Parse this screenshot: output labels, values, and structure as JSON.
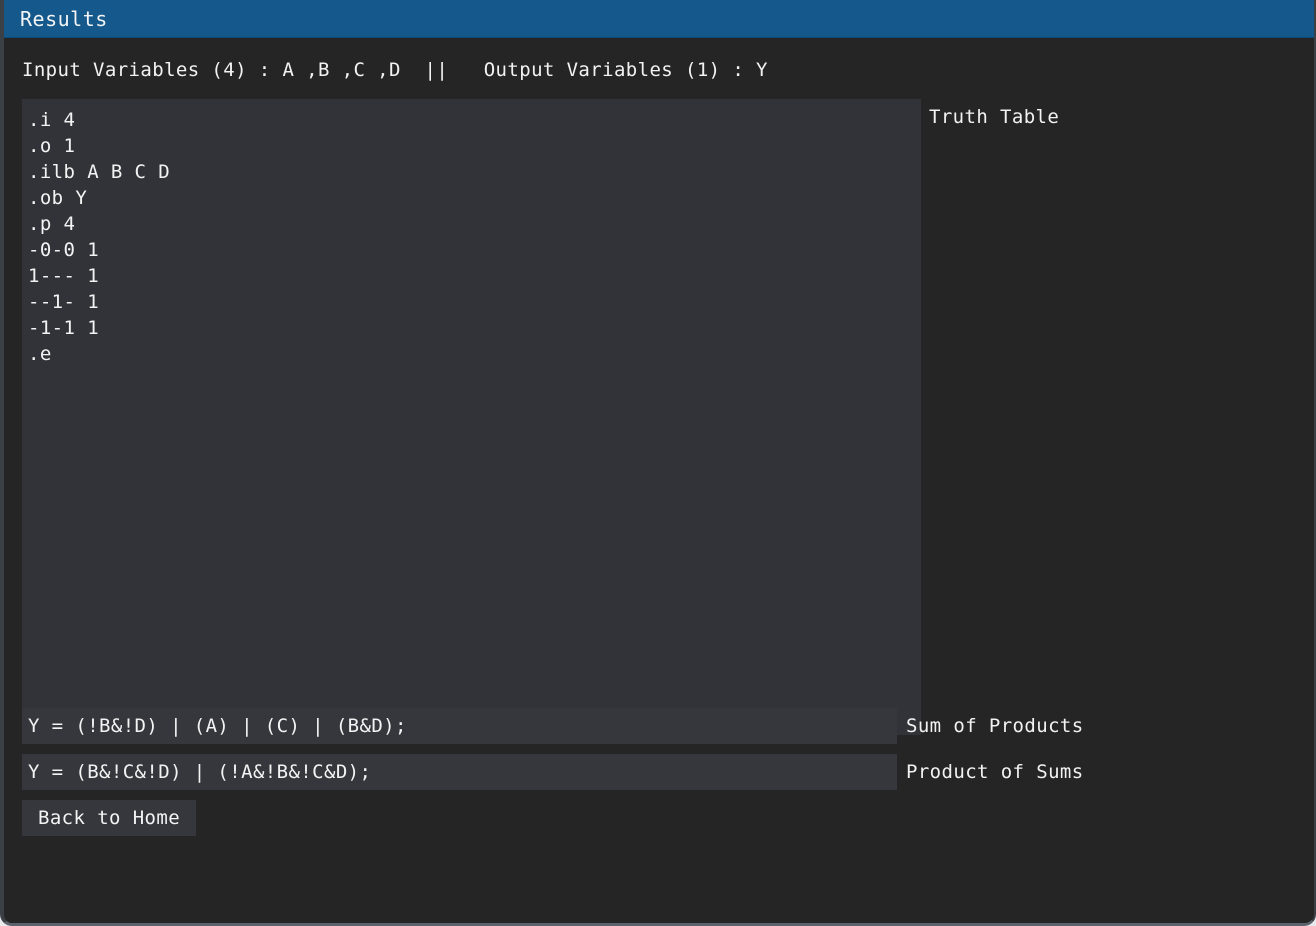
{
  "window": {
    "title": "Results",
    "titlebar_color": "#14588c",
    "background_color": "#252525"
  },
  "header": {
    "variable_summary": "Input Variables (4) : A ,B ,C ,D  ||   Output Variables (1) : Y",
    "input_count": 4,
    "input_variables": [
      "A",
      "B",
      "C",
      "D"
    ],
    "output_count": 1,
    "output_variables": [
      "Y"
    ]
  },
  "main": {
    "pla_label": "Truth Table",
    "pla_text": ".i 4\n.o 1\n.ilb A B C D\n.ob Y\n.p 4\n-0-0 1\n1--- 1\n--1- 1\n-1-1 1\n.e",
    "pla_lines": [
      ".i 4",
      ".o 1",
      ".ilb A B C D",
      ".ob Y",
      ".p 4",
      "-0-0 1",
      "1--- 1",
      "--1- 1",
      "-1-1 1",
      ".e"
    ]
  },
  "expressions": {
    "sop": {
      "value": "Y = (!B&!D) | (A) | (C) | (B&D);",
      "label": "Sum of Products"
    },
    "pos": {
      "value": "Y = (B&!C&!D) | (!A&!B&!C&D);",
      "label": "Product of Sums"
    }
  },
  "actions": {
    "back_label": "Back to Home"
  }
}
